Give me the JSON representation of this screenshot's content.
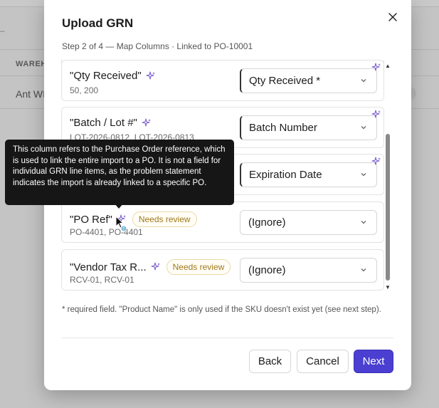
{
  "background": {
    "column_header": "WAREH",
    "row_text": "Ant WI",
    "badge_text": "ed"
  },
  "modal": {
    "title": "Upload GRN",
    "subtitle": "Step 2 of 4 — Map Columns · Linked to PO-10001",
    "close_icon": "close-icon",
    "rows": [
      {
        "name": "\"Qty Received\"",
        "samples": "50, 200",
        "badge": "",
        "selected": "Qty Received *"
      },
      {
        "name": "\"Batch / Lot #\"",
        "samples": "LOT-2026-0812, LOT-2026-0813",
        "badge": "",
        "selected": "Batch Number"
      },
      {
        "name": "",
        "samples": "",
        "badge": "",
        "selected": "Expiration Date"
      },
      {
        "name": "\"PO Ref\"",
        "samples": "PO-4401, PO-4401",
        "badge": "Needs review",
        "selected": "(Ignore)"
      },
      {
        "name": "\"Vendor Tax R...",
        "samples": "RCV-01, RCV-01",
        "badge": "Needs review",
        "selected": "(Ignore)"
      }
    ],
    "footnote": "* required field. \"Product Name\" is only used if the SKU doesn't exist yet (see next step).",
    "buttons": {
      "back": "Back",
      "cancel": "Cancel",
      "next": "Next"
    }
  },
  "tooltip": {
    "text": "This column refers to the Purchase Order reference, which is used to link the entire import to a PO. It is not a field for individual GRN line items, as the problem statement indicates the import is already linked to a specific PO."
  },
  "colors": {
    "accent": "#4b3fd1",
    "sparkle": "#7b5fd0",
    "review_text": "#a0781f"
  }
}
